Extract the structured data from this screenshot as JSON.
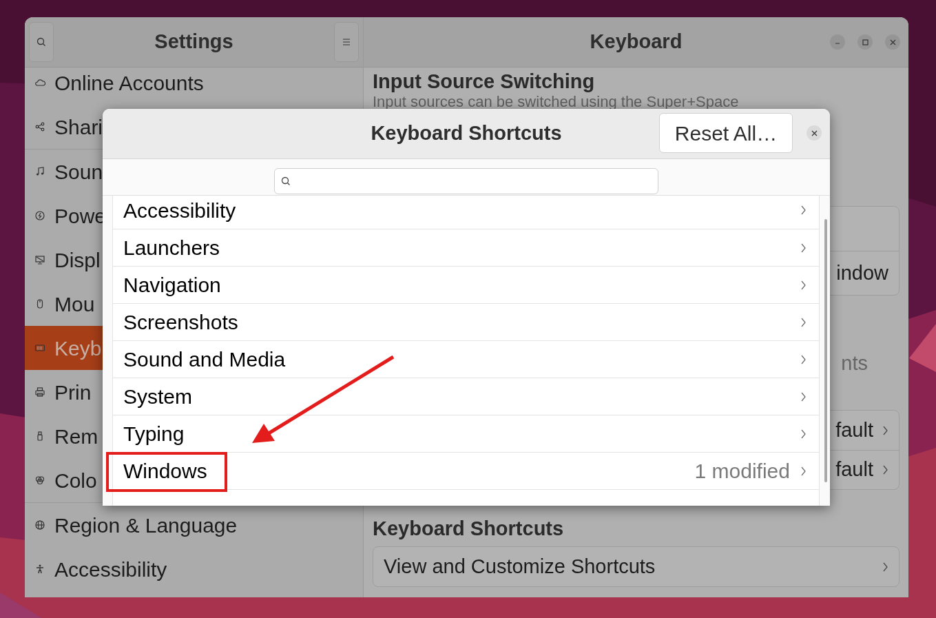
{
  "settings_window": {
    "sidebar_title": "Settings",
    "title": "Keyboard",
    "sidebar": {
      "groups": [
        {
          "items": [
            {
              "label": "Online Accounts",
              "selected": false
            },
            {
              "label": "Shari",
              "selected": false
            }
          ]
        },
        {
          "items": [
            {
              "label": "Soun",
              "selected": false
            },
            {
              "label": "Powe",
              "selected": false
            },
            {
              "label": "Displ",
              "selected": false
            },
            {
              "label": "Mou",
              "selected": false
            },
            {
              "label": "Keyb",
              "selected": true
            },
            {
              "label": "Prin",
              "selected": false
            },
            {
              "label": "Rem",
              "selected": false
            },
            {
              "label": "Colo",
              "selected": false
            }
          ]
        },
        {
          "items": [
            {
              "label": "Region & Language",
              "selected": false
            },
            {
              "label": "Accessibility",
              "selected": false
            }
          ]
        }
      ]
    },
    "content": [
      {
        "kind": "heading",
        "text": "Input Source Switching"
      },
      {
        "kind": "description",
        "text": "Input sources can be switched using the Super+Space"
      },
      {
        "kind": "card",
        "rows": [
          {
            "chevron": false
          },
          {
            "label": "indow",
            "chevron": false
          }
        ]
      },
      {
        "kind": "subheading",
        "text": "nts"
      },
      {
        "kind": "card",
        "rows": [
          {
            "label": "fault",
            "chevron": true
          },
          {
            "label": "fault",
            "chevron": true
          }
        ]
      },
      {
        "kind": "heading",
        "text": "Keyboard Shortcuts"
      },
      {
        "kind": "card",
        "rows": [
          {
            "label": "View and Customize Shortcuts",
            "chevron": true,
            "full": true
          }
        ]
      }
    ]
  },
  "dialog": {
    "title": "Keyboard Shortcuts",
    "reset_button": "Reset All…",
    "categories": [
      {
        "label": "Accessibility"
      },
      {
        "label": "Launchers"
      },
      {
        "label": "Navigation"
      },
      {
        "label": "Screenshots"
      },
      {
        "label": "Sound and Media"
      },
      {
        "label": "System"
      },
      {
        "label": "Typing"
      },
      {
        "label": "Windows",
        "value": "1 modified"
      }
    ]
  }
}
